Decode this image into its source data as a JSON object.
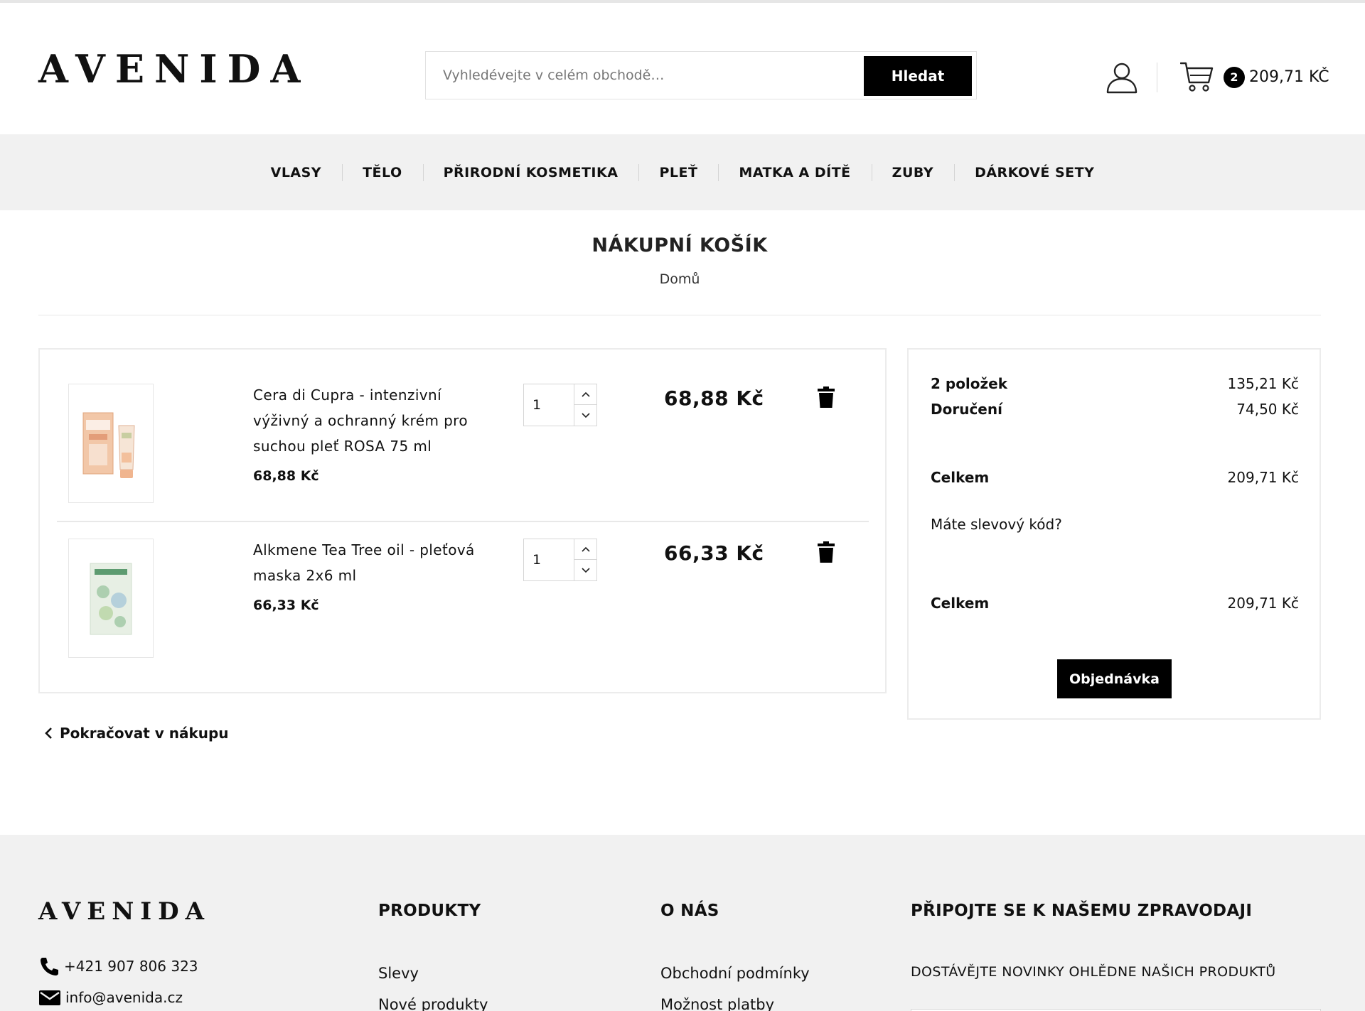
{
  "header": {
    "logo": "AVENIDA",
    "search_placeholder": "Vyhledévejte v celém obchodě…",
    "search_button": "Hledat",
    "cart_count": "2",
    "cart_total": "209,71 KČ"
  },
  "nav": {
    "items": [
      "VLASY",
      "TĚLO",
      "PŘIRODNÍ KOSMETIKA",
      "PLEŤ",
      "MATKA A DÍTĚ",
      "ZUBY",
      "DÁRKOVÉ SETY"
    ]
  },
  "page": {
    "title": "NÁKUPNÍ KOŠÍK",
    "breadcrumb": "Domů"
  },
  "cart": {
    "items": [
      {
        "name": "Cera di Cupra - intenzivní výživný a ochranný krém pro suchou pleť ROSA 75 ml",
        "unit_price": "68,88 Kč",
        "quantity": "1",
        "line_total": "68,88 Kč"
      },
      {
        "name": "Alkmene Tea Tree oil - pleťová maska 2x6 ml",
        "unit_price": "66,33 Kč",
        "quantity": "1",
        "line_total": "66,33 Kč"
      }
    ],
    "continue_label": "Pokračovat v nákupu"
  },
  "summary": {
    "items_label": "2 položek",
    "items_value": "135,21 Kč",
    "delivery_label": "Doručení",
    "delivery_value": "74,50 Kč",
    "total_label": "Celkem",
    "total_value": "209,71 Kč",
    "discount_label": "Máte slevový kód?",
    "total2_label": "Celkem",
    "total2_value": "209,71 Kč",
    "order_button": "Objednávka"
  },
  "footer": {
    "logo": "AVENIDA",
    "phone": "+421 907 806 323",
    "email": "info@avenida.cz",
    "col_products_title": "PRODUKTY",
    "products_links": [
      "Slevy",
      "Nové produkty"
    ],
    "col_about_title": "O NÁS",
    "about_links": [
      "Obchodní podmínky",
      "Možnost platby"
    ],
    "newsletter_title": "PŘIPOJTE SE K NAŠEMU ZPRAVODAJI",
    "newsletter_text": "DOSTÁVĚJTE NOVINKY OHLĚDNE NAŠICH PRODUKTŮ"
  }
}
